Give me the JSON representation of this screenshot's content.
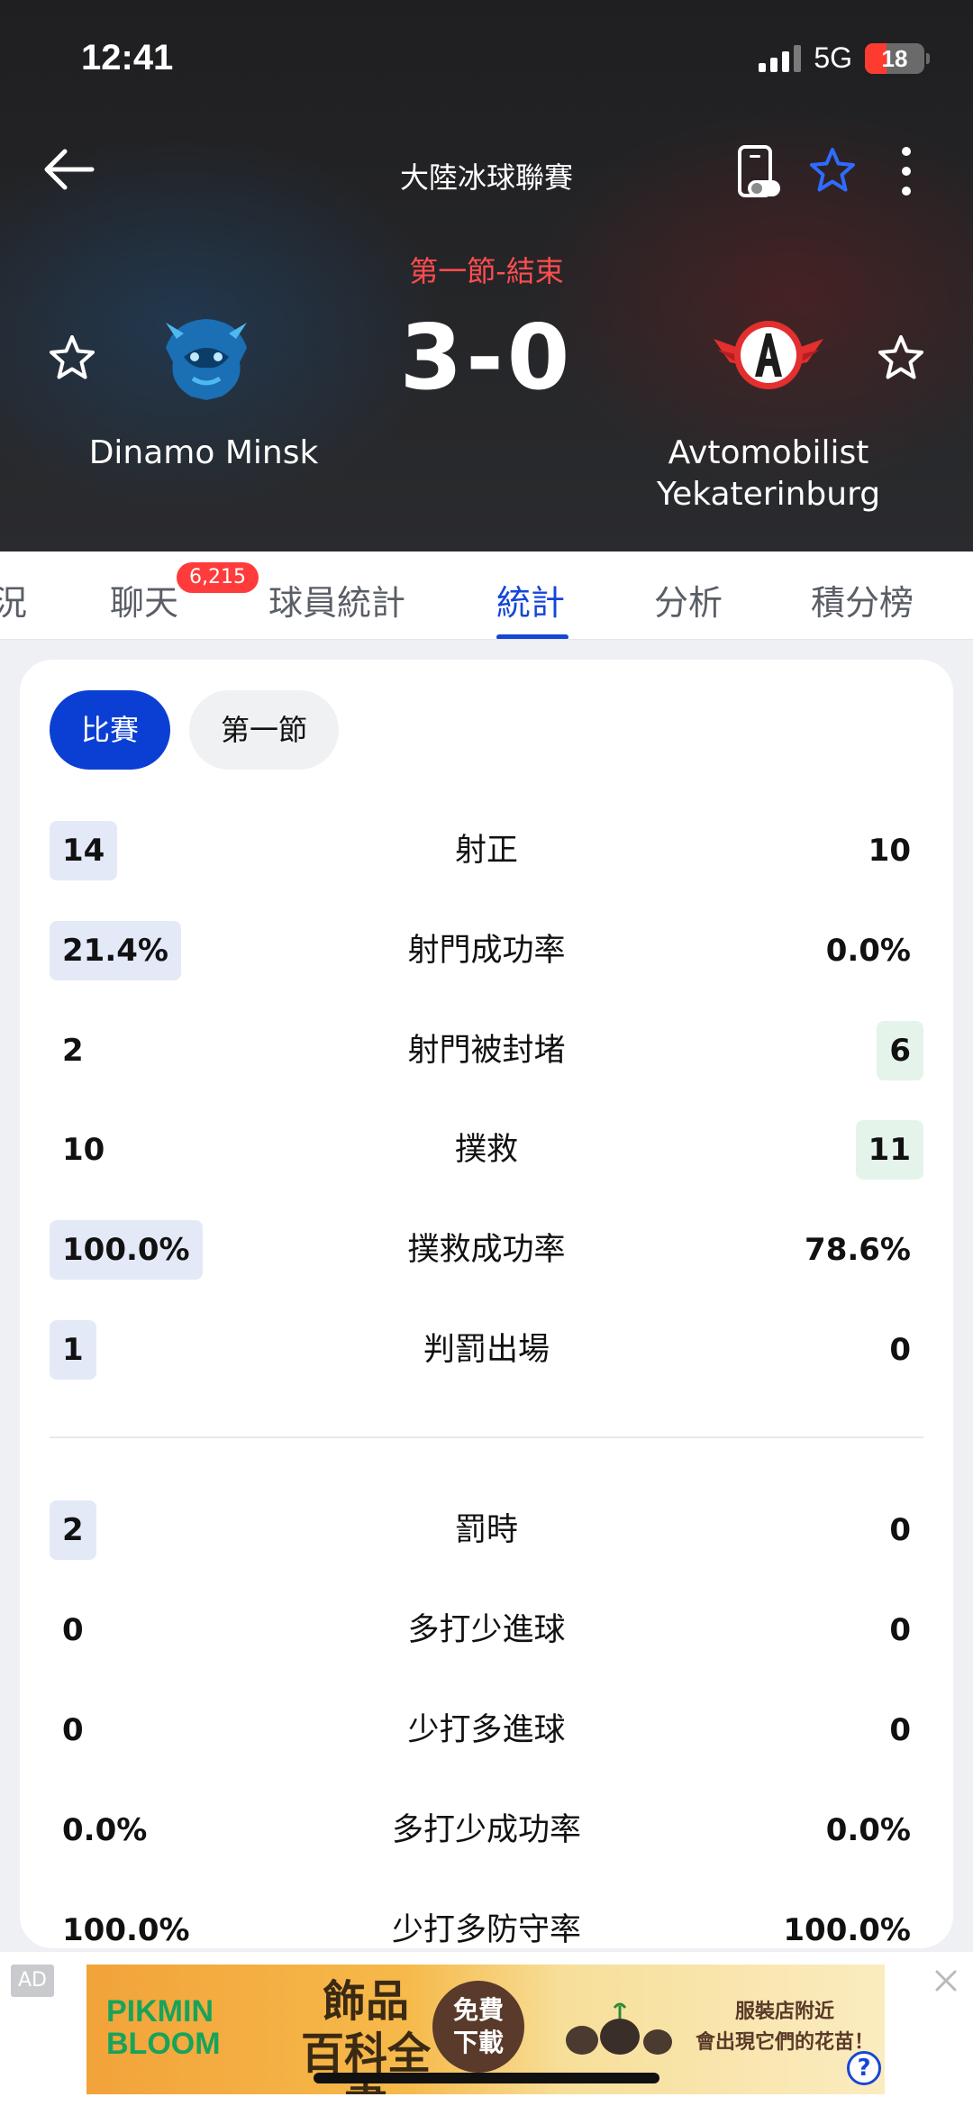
{
  "status_bar": {
    "time": "12:41",
    "network": "5G",
    "battery": "18"
  },
  "header": {
    "league": "大陸冰球聯賽",
    "period": "第一節-結束",
    "score": "3-0"
  },
  "home_team": {
    "name": "Dinamo Minsk"
  },
  "away_team": {
    "name_line1": "Avtomobilist",
    "name_line2": "Yekaterinburg"
  },
  "tabs": [
    {
      "label": "況"
    },
    {
      "label": "聊天",
      "badge": "6,215"
    },
    {
      "label": "球員統計"
    },
    {
      "label": "統計"
    },
    {
      "label": "分析"
    },
    {
      "label": "積分榜"
    }
  ],
  "segments": {
    "match": "比賽",
    "period1": "第一節"
  },
  "stats": [
    {
      "label": "射正",
      "home": "14",
      "away": "10",
      "leader": "home"
    },
    {
      "label": "射門成功率",
      "home": "21.4%",
      "away": "0.0%",
      "leader": "home"
    },
    {
      "label": "射門被封堵",
      "home": "2",
      "away": "6",
      "leader": "away"
    },
    {
      "label": "撲救",
      "home": "10",
      "away": "11",
      "leader": "away"
    },
    {
      "label": "撲救成功率",
      "home": "100.0%",
      "away": "78.6%",
      "leader": "home"
    },
    {
      "label": "判罰出場",
      "home": "1",
      "away": "0",
      "leader": "home"
    }
  ],
  "stats2": [
    {
      "label": "罰時",
      "home": "2",
      "away": "0",
      "leader": "home"
    },
    {
      "label": "多打少進球",
      "home": "0",
      "away": "0",
      "leader": "none"
    },
    {
      "label": "少打多進球",
      "home": "0",
      "away": "0",
      "leader": "none"
    },
    {
      "label": "多打少成功率",
      "home": "0.0%",
      "away": "0.0%",
      "leader": "none"
    },
    {
      "label": "少打多防守率",
      "home": "100.0%",
      "away": "100.0%",
      "leader": "none"
    }
  ],
  "ad": {
    "tag": "AD",
    "logo_line1": "PIKMIN",
    "logo_line2": "BLOOM",
    "title_line1": "飾品",
    "title_line2": "百科全書",
    "cta_line1": "免費",
    "cta_line2": "下載",
    "side_line1": "服裝店附近",
    "side_line2": "會出現它們的花苗！",
    "help": "?"
  },
  "colors": {
    "accent": "#1646d6",
    "segment_active": "#0b3fd4",
    "period_red": "#ff4d4f",
    "home_highlight": "#e4e9f7",
    "away_highlight": "#e5f4ea"
  }
}
